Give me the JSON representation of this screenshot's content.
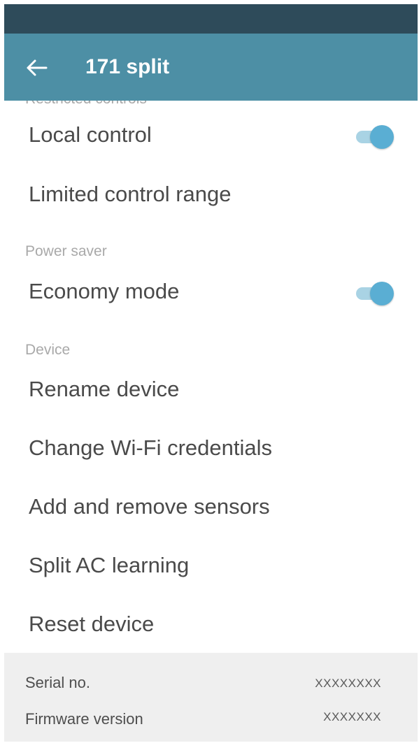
{
  "app_bar": {
    "back_icon": "arrow-left-icon",
    "title": "171 split",
    "colors": {
      "status_bar": "#2e4b5a",
      "app_bar": "#4d8fa5",
      "toggle_on": "#5aaed3"
    }
  },
  "settings": {
    "cut_section": "Restricted controls",
    "local_control": {
      "label": "Local control",
      "on": true
    },
    "limited_range": {
      "label": "Limited control range"
    },
    "power_saver_header": "Power saver",
    "economy_mode": {
      "label": "Economy mode",
      "on": true
    },
    "device_header": "Device",
    "rename": "Rename device",
    "wifi": "Change Wi-Fi credentials",
    "sensors": "Add and remove sensors",
    "learning": "Split AC learning",
    "reset": "Reset device"
  },
  "footer": {
    "serial_label": "Serial no.",
    "serial_value": "XXXXXXXX",
    "firmware_label": "Firmware version",
    "firmware_value": "XXXXXXX"
  }
}
